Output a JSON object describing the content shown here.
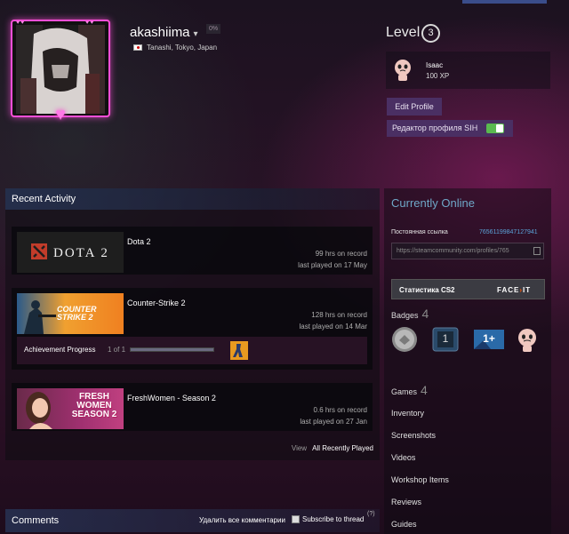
{
  "profile": {
    "username": "akashiima",
    "xp_percent": "0%",
    "location": "Tanashi, Tokyo, Japan",
    "level_label": "Level",
    "level": "3"
  },
  "favorite_badge": {
    "name": "Isaac",
    "xp": "100 XP"
  },
  "buttons": {
    "edit_profile": "Edit Profile",
    "sih_editor": "Редактор профиля SIH"
  },
  "activity": {
    "title": "Recent Activity",
    "games": [
      {
        "name": "Dota 2",
        "capsule_text": "DOTA 2",
        "hours": "99 hrs on record",
        "last_played": "last played on 17 May"
      },
      {
        "name": "Counter-Strike 2",
        "capsule_text": "COUNTER STRIKE 2",
        "hours": "128 hrs on record",
        "last_played": "last played on 14 Mar",
        "achievement": {
          "label": "Achievement Progress",
          "count": "1 of 1",
          "progress": 1.0
        }
      },
      {
        "name": "FreshWomen - Season 2",
        "capsule_text": "FRESH WOMEN SEASON 2",
        "hours": "0.6 hrs on record",
        "last_played": "last played on 27 Jan"
      }
    ],
    "view_label": "View",
    "view_link": "All Recently Played"
  },
  "comments": {
    "title": "Comments",
    "delete_all": "Удалить все комментарии",
    "subscribe": "Subscribe to thread",
    "help": "(?)"
  },
  "sidebar": {
    "status": "Currently Online",
    "permalink_label": "Постоянная ссылка",
    "permalink_id": "76561199847127941",
    "permalink_url": "https://steamcommunity.com/profiles/765",
    "cs2_stats": "Статистика CS2",
    "faceit": "FACE",
    "faceit_suffix": "IT",
    "badges_label": "Badges",
    "badges_count": "4",
    "badge_level_1": "1",
    "badge_level_2": "1+",
    "games_label": "Games",
    "games_count": "4",
    "links": [
      "Inventory",
      "Screenshots",
      "Videos",
      "Workshop Items",
      "Reviews",
      "Guides"
    ]
  },
  "colors": {
    "accent_blue": "#6fa8c8",
    "link_blue": "#5aa3d8",
    "avatar_frame": "#ff4fd8",
    "button_bg": "#4a2f63",
    "toggle_on": "#5ab94f"
  }
}
